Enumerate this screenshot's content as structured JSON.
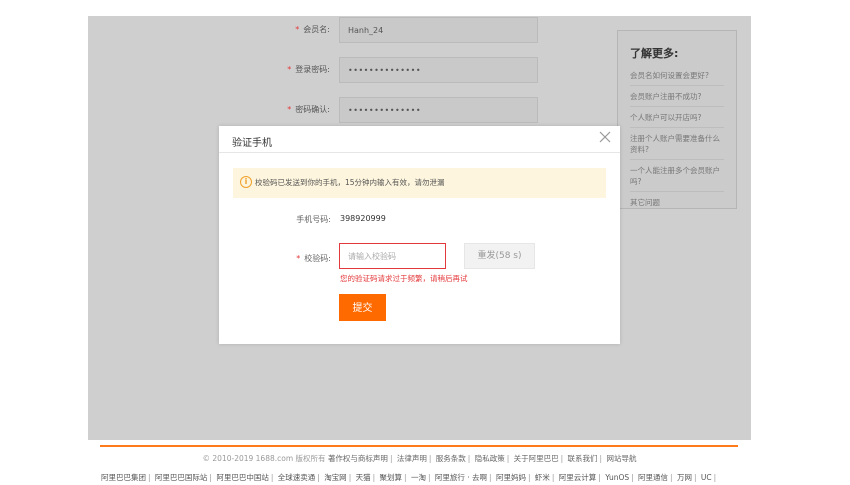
{
  "form": {
    "member_label": "会员名:",
    "member_value": "Hanh_24",
    "password_label": "登录密码:",
    "password_value": "••••••••••••••",
    "confirm_label": "密码确认:",
    "confirm_value": "••••••••••••••"
  },
  "help": {
    "title": "了解更多:",
    "items": [
      "会员名如何设置会更好?",
      "会员账户注册不成功?",
      "个人账户可以开店吗?",
      "注册个人账户需要准备什么资料?",
      "一个人能注册多个会员账户吗?",
      "其它问题"
    ]
  },
  "modal": {
    "title": "验证手机",
    "close_icon": "close-icon",
    "notice_icon": "info-icon",
    "notice_text": "校验码已发送到你的手机，15分钟内输入有效，请勿泄漏",
    "phone_label": "手机号码:",
    "phone_value": "398920999",
    "code_label": "校验码:",
    "code_placeholder": "请输入校验码",
    "resend_label": "重发(58 s)",
    "error_text": "您的验证码请求过于频繁，请稍后再试",
    "submit_label": "提交"
  },
  "footer": {
    "copyright": "© 2010-2019 1688.com 版权所有",
    "links1": [
      "著作权与商标声明",
      "法律声明",
      "服务条款",
      "隐私政策",
      "关于阿里巴巴",
      "联系我们",
      "网站导航"
    ],
    "links2": [
      "阿里巴巴集团",
      "阿里巴巴国际站",
      "阿里巴巴中国站",
      "全球速卖通",
      "淘宝网",
      "天猫",
      "聚划算",
      "一淘",
      "阿里旅行 · 去啊",
      "阿里妈妈",
      "虾米",
      "阿里云计算",
      "YunOS",
      "阿里通信",
      "万网",
      "UC"
    ]
  },
  "colors": {
    "accent": "#ff6a00",
    "error": "#e4393c",
    "overlay": "#cfcfcf",
    "notice_bg": "#fdf5dd"
  }
}
